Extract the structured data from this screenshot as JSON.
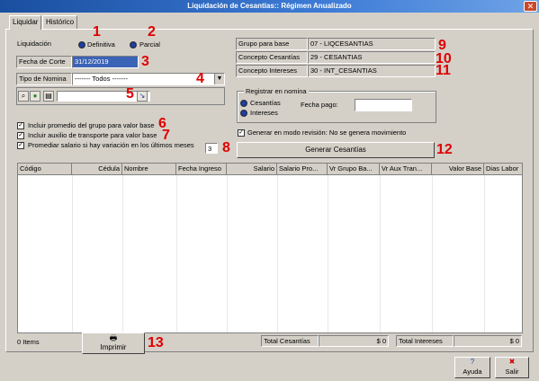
{
  "window": {
    "title": "Liquidación de Cesantías:: Régimen Anualizado",
    "close_glyph": "✕"
  },
  "tabs": [
    {
      "label": "Liquidar"
    },
    {
      "label": "Histórico"
    }
  ],
  "liquidacion": {
    "label": "Liquidación",
    "option1": "Definitiva",
    "option2": "Parcial"
  },
  "fecha_corte": {
    "label": "Fecha de Corte",
    "value": "31/12/2019"
  },
  "tipo_nomina": {
    "label": "Tipo de Nomina",
    "value": "------- Todos -------"
  },
  "checks": {
    "promedio": "Incluir promedio del grupo para valor base",
    "auxilio": "Incluir auxilio de transporte para valor base",
    "promediar": "Promediar salario si hay variación en los últimos meses",
    "meses_value": "3"
  },
  "right_info": {
    "grupo_label": "Grupo para base",
    "grupo_value": "07 - LIQCESANTIAS",
    "cesantias_label": "Concepto Cesantías",
    "cesantias_value": "29 - CESANTIAS",
    "intereses_label": "Concepto Intereses",
    "intereses_value": "30 - INT_CESANTIAS"
  },
  "registrar": {
    "title": "Registrar en nomina",
    "opt1": "Cesantías",
    "opt2": "Intereses",
    "fecha_pago_label": "Fecha pago:",
    "fecha_pago_value": ""
  },
  "revision": "Generar en modo revisión: No se genera movimiento",
  "generar_button": "Generar Cesantías",
  "grid_columns": [
    "Código",
    "Cédula",
    "Nombre",
    "Fecha Ingreso",
    "Salario",
    "Salario Pro...",
    "Vr Grupo Ba...",
    "Vr Aux Tran...",
    "Valor Base",
    "Dias Labor"
  ],
  "footer": {
    "items": "0 Items",
    "imprimir": "Imprimir",
    "total_cesantias_label": "Total Cesantías",
    "total_cesantias_value": "$ 0",
    "total_intereses_label": "Total Intereses",
    "total_intereses_value": "$ 0"
  },
  "bottom_buttons": {
    "ayuda": "Ayuda",
    "salir": "Salir"
  },
  "annotations": [
    "1",
    "2",
    "3",
    "4",
    "5",
    "6",
    "7",
    "8",
    "9",
    "10",
    "11",
    "12",
    "13"
  ],
  "colors": {
    "annotation": "#e00000",
    "titlebar": "#1a4fa0"
  }
}
